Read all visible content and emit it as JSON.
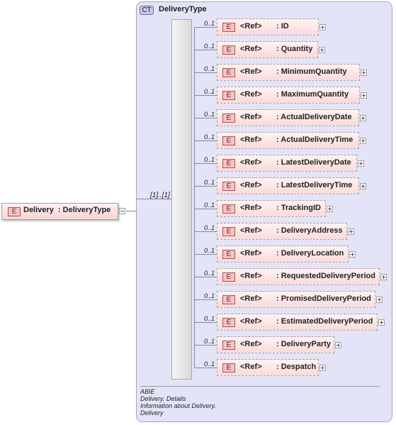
{
  "root": {
    "badge": "E",
    "label": "Delivery  : DeliveryType"
  },
  "complex_type": {
    "badge": "CT",
    "name": "DeliveryType"
  },
  "sequence": {
    "multiplicity": "[1]..[1]"
  },
  "children": [
    {
      "occurrence": "0..1",
      "badge": "E",
      "ref": "<Ref>",
      "name": ": ID"
    },
    {
      "occurrence": "0..1",
      "badge": "E",
      "ref": "<Ref>",
      "name": ": Quantity"
    },
    {
      "occurrence": "0..1",
      "badge": "E",
      "ref": "<Ref>",
      "name": ": MinimumQuantity"
    },
    {
      "occurrence": "0..1",
      "badge": "E",
      "ref": "<Ref>",
      "name": ": MaximumQuantity"
    },
    {
      "occurrence": "0..1",
      "badge": "E",
      "ref": "<Ref>",
      "name": ": ActualDeliveryDate"
    },
    {
      "occurrence": "0..1",
      "badge": "E",
      "ref": "<Ref>",
      "name": ": ActualDeliveryTime"
    },
    {
      "occurrence": "0..1",
      "badge": "E",
      "ref": "<Ref>",
      "name": ": LatestDeliveryDate"
    },
    {
      "occurrence": "0..1",
      "badge": "E",
      "ref": "<Ref>",
      "name": ": LatestDeliveryTime"
    },
    {
      "occurrence": "0..1",
      "badge": "E",
      "ref": "<Ref>",
      "name": ": TrackingID"
    },
    {
      "occurrence": "0..1",
      "badge": "E",
      "ref": "<Ref>",
      "name": ": DeliveryAddress"
    },
    {
      "occurrence": "0..1",
      "badge": "E",
      "ref": "<Ref>",
      "name": ": DeliveryLocation"
    },
    {
      "occurrence": "0..1",
      "badge": "E",
      "ref": "<Ref>",
      "name": ": RequestedDeliveryPeriod"
    },
    {
      "occurrence": "0..1",
      "badge": "E",
      "ref": "<Ref>",
      "name": ": PromisedDeliveryPeriod"
    },
    {
      "occurrence": "0..1",
      "badge": "E",
      "ref": "<Ref>",
      "name": ": EstimatedDeliveryPeriod"
    },
    {
      "occurrence": "0..1",
      "badge": "E",
      "ref": "<Ref>",
      "name": ": DeliveryParty"
    },
    {
      "occurrence": "0..1",
      "badge": "E",
      "ref": "<Ref>",
      "name": ": Despatch"
    }
  ],
  "annotation": [
    "ABIE",
    "Delivery. Details",
    "Information about Delivery.",
    "Delivery"
  ]
}
